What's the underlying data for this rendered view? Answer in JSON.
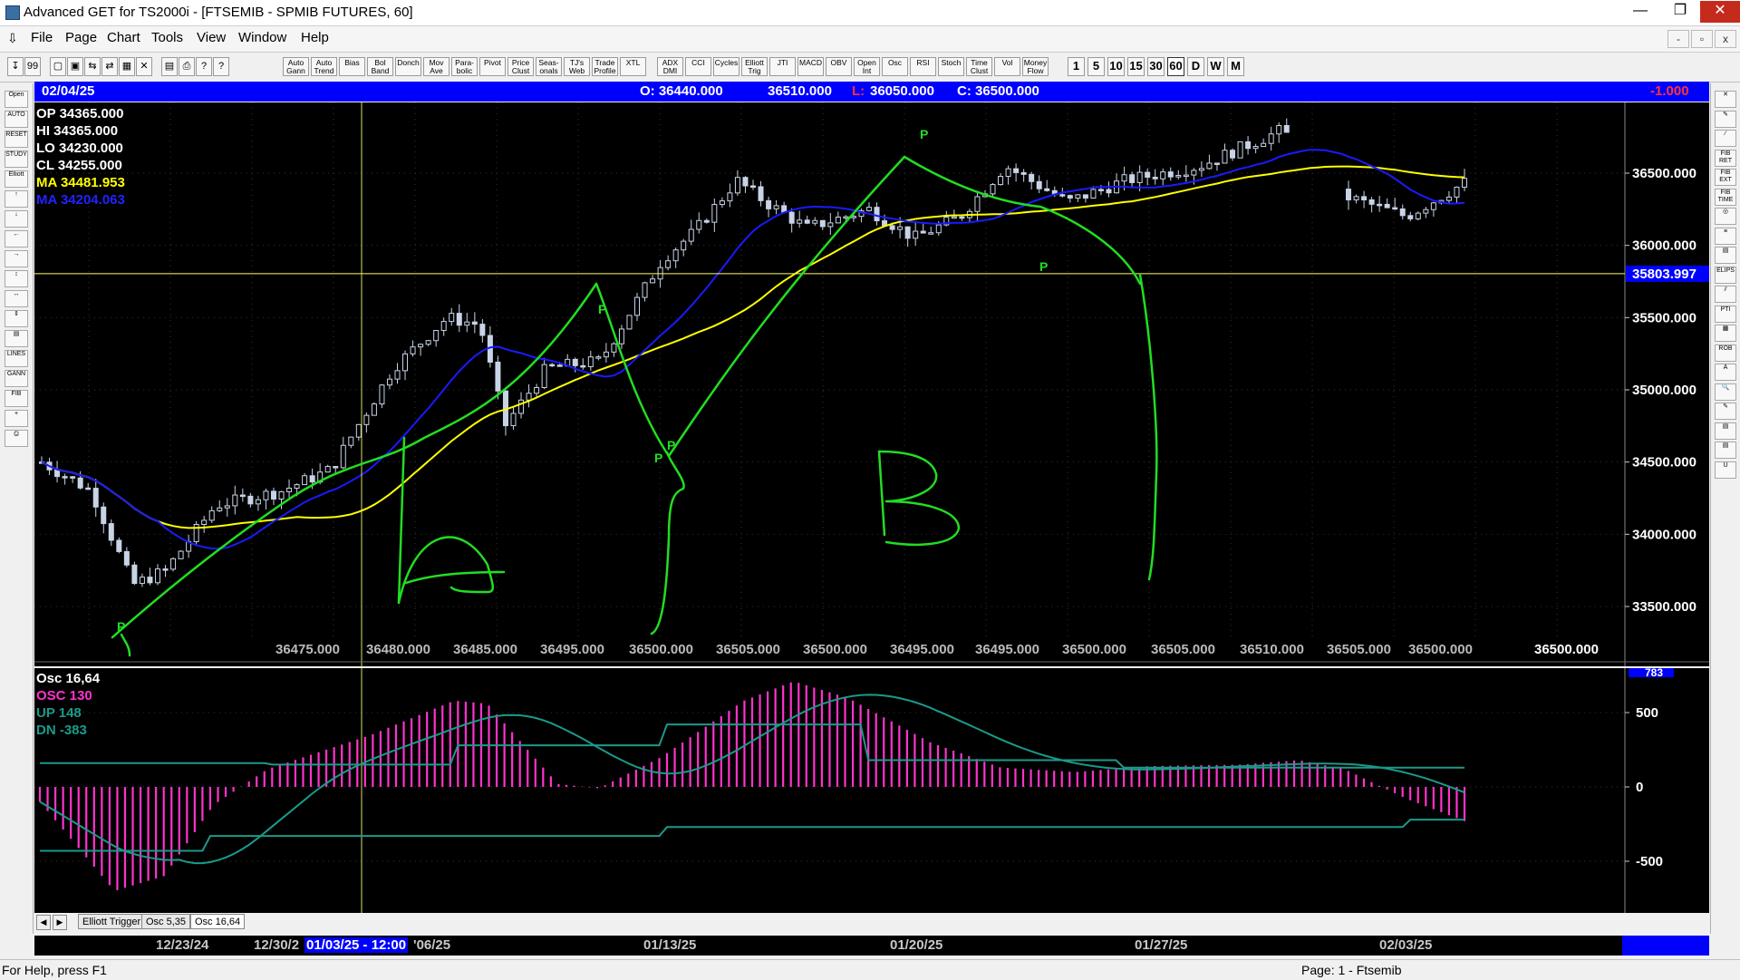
{
  "window": {
    "title": "Advanced GET for TS2000i - [FTSEMIB - SPMIB FUTURES, 60]",
    "minimize": "—",
    "maximize": "❐",
    "close": "✕"
  },
  "menu": {
    "items": [
      "File",
      "Page",
      "Chart",
      "Tools",
      "View",
      "Window",
      "Help"
    ],
    "mdi_controls": [
      "-",
      "▫",
      "x"
    ]
  },
  "toolbar": {
    "file_buttons": [
      "↧",
      "99",
      "▢",
      "▣",
      "⇆",
      "⇄",
      "▦",
      "✕",
      "▤",
      "⎙",
      "?",
      "?"
    ],
    "study_buttons": [
      "Auto Gann",
      "Auto Trend",
      "Bias",
      "Bol Band",
      "Donch",
      "Mov Ave",
      "Para-bolic",
      "Pivot",
      "Price Clust",
      "Seas-onals",
      "TJ's Web",
      "Trade Profile",
      "XTL",
      "ADX DMI",
      "CCI",
      "Cycles",
      "Elliott Trig",
      "JTI",
      "MACD",
      "OBV",
      "Open Int",
      "Osc",
      "RSI",
      "Stoch",
      "Time Clust",
      "Vol",
      "Money Flow"
    ],
    "interval_buttons": [
      "1",
      "5",
      "10",
      "15",
      "30",
      "60",
      "D",
      "W",
      "M"
    ],
    "active_interval": "60"
  },
  "left_tools": [
    "Open",
    "AUTO",
    "RESET",
    "STUDY",
    "Elliott",
    "↑",
    "↓",
    "←",
    "→",
    "↕",
    "↔",
    "⇕",
    "▤",
    "LINES",
    "GANN",
    "FIB",
    "+",
    "⎙"
  ],
  "right_tools": [
    "✕",
    "✎",
    "∕",
    "FIB RET",
    "FIB EXT",
    "FIB TIME",
    "◎",
    "≡",
    "▤",
    "ELIPS",
    "⫽",
    "PTI",
    "▦",
    "ROB",
    "A",
    "🔍",
    "✎",
    "▤",
    "▤",
    "U"
  ],
  "header": {
    "date": "02/04/25",
    "open": "O: 36440.000",
    "high": "36510.000",
    "low_label": "L:",
    "low_value": "36050.000",
    "close": "C: 36500.000",
    "change": "-1.000"
  },
  "info_panel": {
    "op": "OP  34365.000",
    "hi": "HI   34365.000",
    "lo": "LO   34230.000",
    "cl": "CL   34255.000",
    "ma_yellow": "MA  34481.953",
    "ma_blue": "MA  34204.063"
  },
  "price_axis": {
    "labels": [
      "36500.000",
      "36000.000",
      "35500.000",
      "35000.000",
      "34500.000",
      "34000.000",
      "33500.000"
    ],
    "crosshair_label": "35803.997",
    "bottom_value": "36500.000"
  },
  "price_readouts": [
    "36475.000",
    "36480.000",
    "36485.000",
    "36495.000",
    "36500.000",
    "36505.000",
    "36500.000",
    "36495.000",
    "36495.000",
    "36500.000",
    "36505.000",
    "36510.000",
    "36505.000",
    "36500.000"
  ],
  "pivot_label": "P",
  "annotations": {
    "letter_a": "A",
    "letter_b": "B"
  },
  "oscillator": {
    "title": "Osc 16,64",
    "osc": "OSC 130",
    "up": "UP    148",
    "dn": "DN    -383",
    "axis_labels": [
      "500",
      "0",
      "-500"
    ],
    "top_value": "783"
  },
  "tabs": {
    "items": [
      "Elliott Trigger",
      "Osc 5,35",
      "Osc 16,64"
    ],
    "active": "Osc 16,64",
    "nav": [
      "◀",
      "▶"
    ]
  },
  "time_axis": {
    "labels": [
      "12/23/24",
      "12/30/2",
      "'06/25",
      "01/13/25",
      "01/20/25",
      "01/27/25",
      "02/03/25"
    ],
    "cursor_label": "01/03/25 - 12:00"
  },
  "status": {
    "help": "For Help, press F1",
    "page": "Page: 1 - Ftsemib"
  },
  "colors": {
    "chart_bg": "#000000",
    "header_bar": "#0000ff",
    "ma_yellow": "#ffff00",
    "ma_blue": "#1a1aff",
    "drawing_green": "#22dd22",
    "osc_magenta": "#ff33cc",
    "band_teal": "#1a9a8a",
    "candles": "#c8d4e6"
  },
  "chart_data": {
    "type": "candlestick",
    "ylim": [
      33300,
      36900
    ],
    "start_price": 34500,
    "bar_count": 185,
    "ma_yellow_last": 34481.953,
    "ma_blue_last": 34204.063,
    "crosshair_price": 35803.997,
    "osc": {
      "ylim": [
        -800,
        800
      ],
      "value": 130,
      "up": 148,
      "dn": -383
    }
  }
}
